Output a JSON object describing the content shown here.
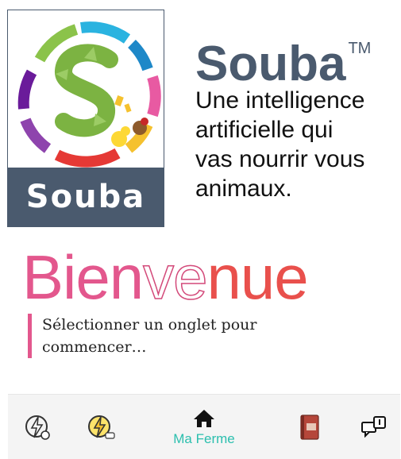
{
  "logo": {
    "band_text": "Souba",
    "icon": "souba-logo-ring"
  },
  "brand": {
    "name": "Souba",
    "trademark": "TM",
    "tagline_lines": [
      "Une intelligence",
      "artificielle qui",
      "vas nourrir vous",
      "animaux."
    ]
  },
  "welcome": {
    "part1": "Bien",
    "part2": "ve",
    "part3": "nue"
  },
  "instructions": {
    "line1": "Sélectionner un onglet pour",
    "line2": "commencer…"
  },
  "tabs": [
    {
      "icon": "bolt-gear-icon"
    },
    {
      "icon": "bolt-pro-icon"
    },
    {
      "icon": "home-icon",
      "label": "Ma Ferme",
      "active": true
    },
    {
      "icon": "book-icon"
    },
    {
      "icon": "chat-devices-icon"
    }
  ],
  "colors": {
    "brand": "#4a5a6e",
    "accent": "#e3578d",
    "active_tab": "#2bbfae"
  }
}
